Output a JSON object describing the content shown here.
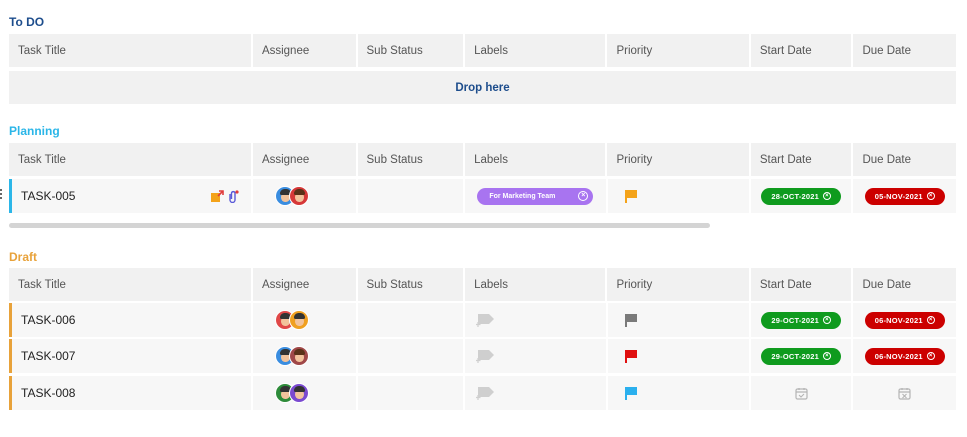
{
  "columns": {
    "title": "Task Title",
    "assignee": "Assignee",
    "sub_status": "Sub Status",
    "labels": "Labels",
    "priority": "Priority",
    "start_date": "Start Date",
    "due_date": "Due Date"
  },
  "groups": [
    {
      "name": "To DO",
      "color": "#1d4d8c",
      "drop_text": "Drop here",
      "tasks": []
    },
    {
      "name": "Planning",
      "color": "#2bb6e8",
      "tasks": [
        {
          "title": "TASK-005",
          "label": "For Marketing Team",
          "priority_color": "#f4a31a",
          "start_date": "28-OCT-2021",
          "due_date": "05-NOV-2021"
        }
      ]
    },
    {
      "name": "Draft",
      "color": "#e8a23a",
      "tasks": [
        {
          "title": "TASK-006",
          "priority_color": "#7a7a7a",
          "start_date": "29-OCT-2021",
          "due_date": "06-NOV-2021"
        },
        {
          "title": "TASK-007",
          "priority_color": "#e01010",
          "start_date": "29-OCT-2021",
          "due_date": "06-NOV-2021"
        },
        {
          "title": "TASK-008",
          "priority_color": "#2bb0ee",
          "start_date": "",
          "due_date": ""
        }
      ]
    }
  ],
  "colors": {
    "start_pill": "#0f9b1e",
    "due_pill": "#cc0000",
    "label_pill": "#a874f0"
  },
  "icons": {
    "attachment": "paperclip-icon",
    "assign": "assign-icon",
    "add_label": "add-label-icon",
    "calendar": "calendar-icon"
  }
}
